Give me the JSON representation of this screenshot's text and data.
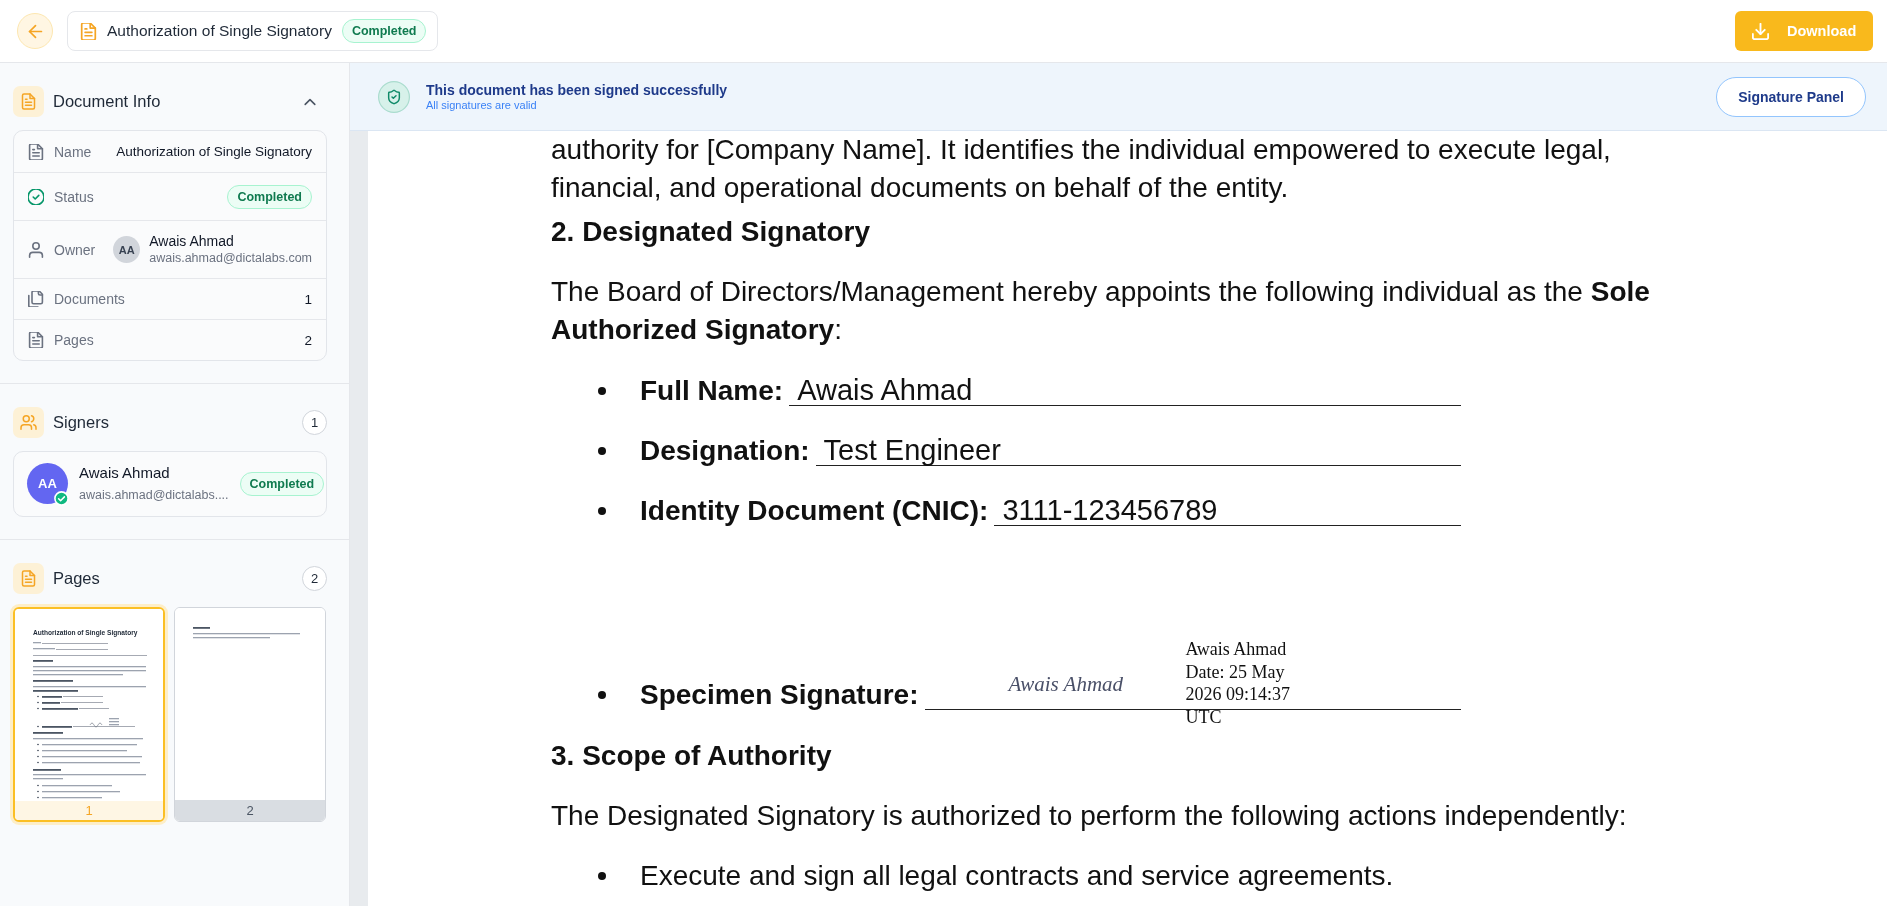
{
  "header": {
    "document_title": "Authorization of Single Signatory",
    "status": "Completed",
    "download_button": "Download"
  },
  "sidebar": {
    "document_info": {
      "title": "Document Info",
      "expanded": true,
      "rows": [
        {
          "kind": "text",
          "label": "Name",
          "value": "Authorization of Single Signatory"
        },
        {
          "kind": "badge",
          "label": "Status",
          "value": "Completed"
        },
        {
          "kind": "person",
          "label": "Owner",
          "initials": "AA",
          "name": "Awais Ahmad",
          "email": "awais.ahmad@dictalabs.com"
        },
        {
          "kind": "text",
          "label": "Documents",
          "value": "1"
        },
        {
          "kind": "text",
          "label": "Pages",
          "value": "2"
        }
      ]
    },
    "signers": {
      "title": "Signers",
      "count": "1",
      "items": [
        {
          "initials": "AA",
          "name": "Awais Ahmad",
          "email": "awais.ahmad@dictalabs....",
          "status": "Completed",
          "signed": true
        }
      ]
    },
    "pages": {
      "title": "Pages",
      "count": "2",
      "thumbnails": [
        {
          "title": "Authorization of Single Signatory",
          "number": "1",
          "selected": true
        },
        {
          "number": "2",
          "selected": false
        }
      ]
    }
  },
  "banner": {
    "title": "This document has been signed successfully",
    "subtitle": "All signatures are valid",
    "button": "Signature Panel"
  },
  "document": {
    "blocks": [
      {
        "kind": "paragraph",
        "text": "authority for [Company Name]. It identifies the individual empowered to execute legal, financial, and operational documents on behalf of the entity."
      },
      {
        "kind": "heading",
        "text": "2. Designated Signatory"
      },
      {
        "kind": "paragraph",
        "text": "The Board of Directors/Management hereby appoints the following individual as the **Sole Authorized Signatory**:"
      },
      {
        "kind": "field",
        "label": "Full Name:",
        "value": "Awais Ahmad"
      },
      {
        "kind": "field",
        "label": "Designation:",
        "value": "Test Engineer"
      },
      {
        "kind": "field",
        "label": "Identity Document (CNIC):",
        "value": "3111-123456789"
      },
      {
        "kind": "signature",
        "label": "Specimen Signature:",
        "signature": "Awais Ahmad",
        "stamp": [
          "Awais Ahmad",
          "Date: 25 May",
          "2026 09:14:37",
          "UTC"
        ]
      },
      {
        "kind": "heading",
        "text": "3. Scope of Authority"
      },
      {
        "kind": "paragraph",
        "text": "The Designated Signatory is authorized to perform the following actions independently:"
      },
      {
        "kind": "bullet",
        "text": "Execute and sign all legal contracts and service agreements."
      }
    ]
  }
}
